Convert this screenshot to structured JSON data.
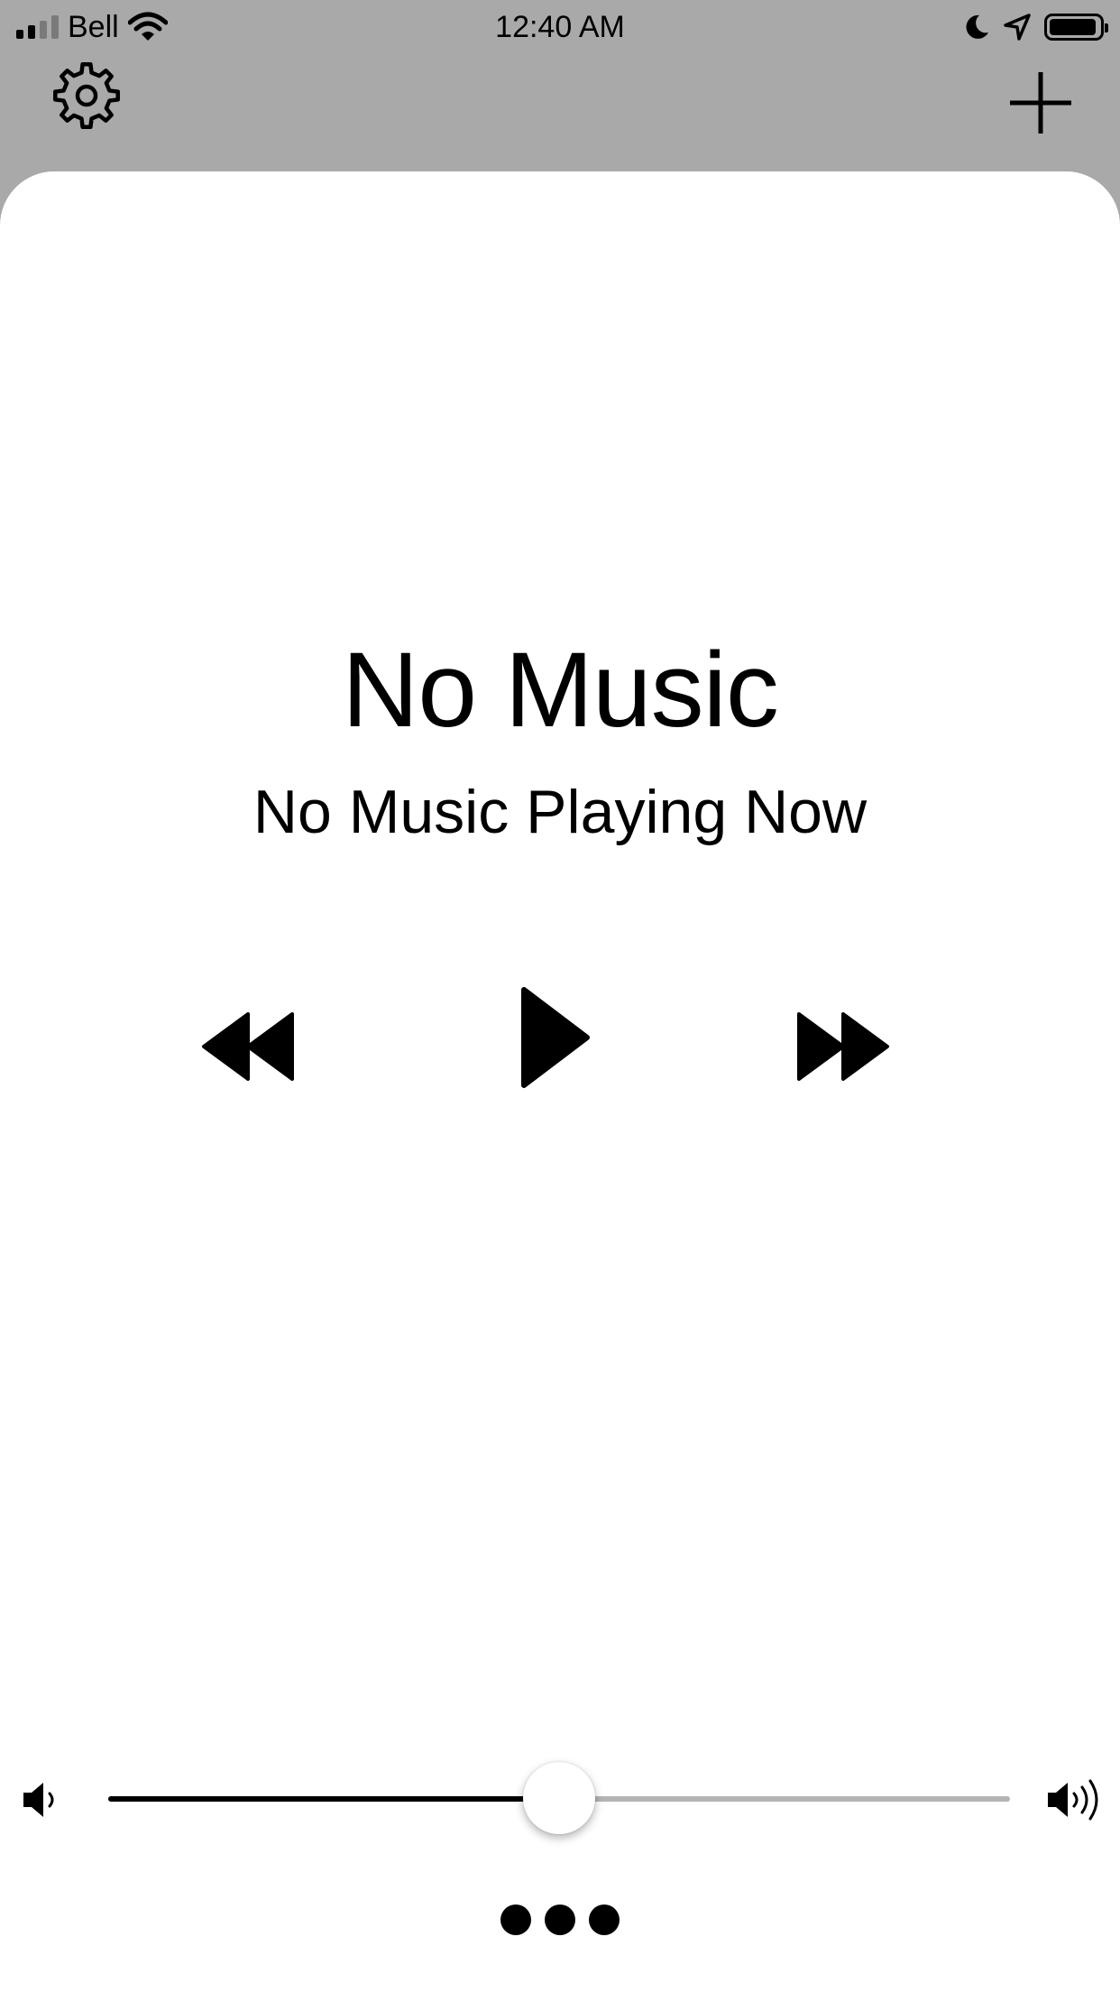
{
  "status_bar": {
    "carrier": "Bell",
    "time": "12:40 AM",
    "signal_bars_active": 2,
    "signal_bars_total": 4,
    "battery_level": 0.95,
    "icons": [
      "signal-icon",
      "wifi-icon",
      "moon-icon",
      "location-arrow-icon",
      "battery-icon"
    ]
  },
  "toolbar": {
    "settings_icon": "gear-icon",
    "add_icon": "plus-icon"
  },
  "now_playing": {
    "title": "No Music",
    "subtitle": "No Music Playing Now"
  },
  "controls": {
    "previous_icon": "rewind-icon",
    "play_icon": "play-icon",
    "next_icon": "fast-forward-icon"
  },
  "volume": {
    "level": 0.5,
    "min_icon": "speaker-low-icon",
    "max_icon": "speaker-high-icon"
  },
  "more_icon": "more-dots-icon",
  "colors": {
    "header_background": "#a9a9a9",
    "card_background": "#ffffff",
    "track_inactive": "#b4b4b4",
    "track_active": "#000000",
    "signal_inactive": "#7a7a7a"
  }
}
